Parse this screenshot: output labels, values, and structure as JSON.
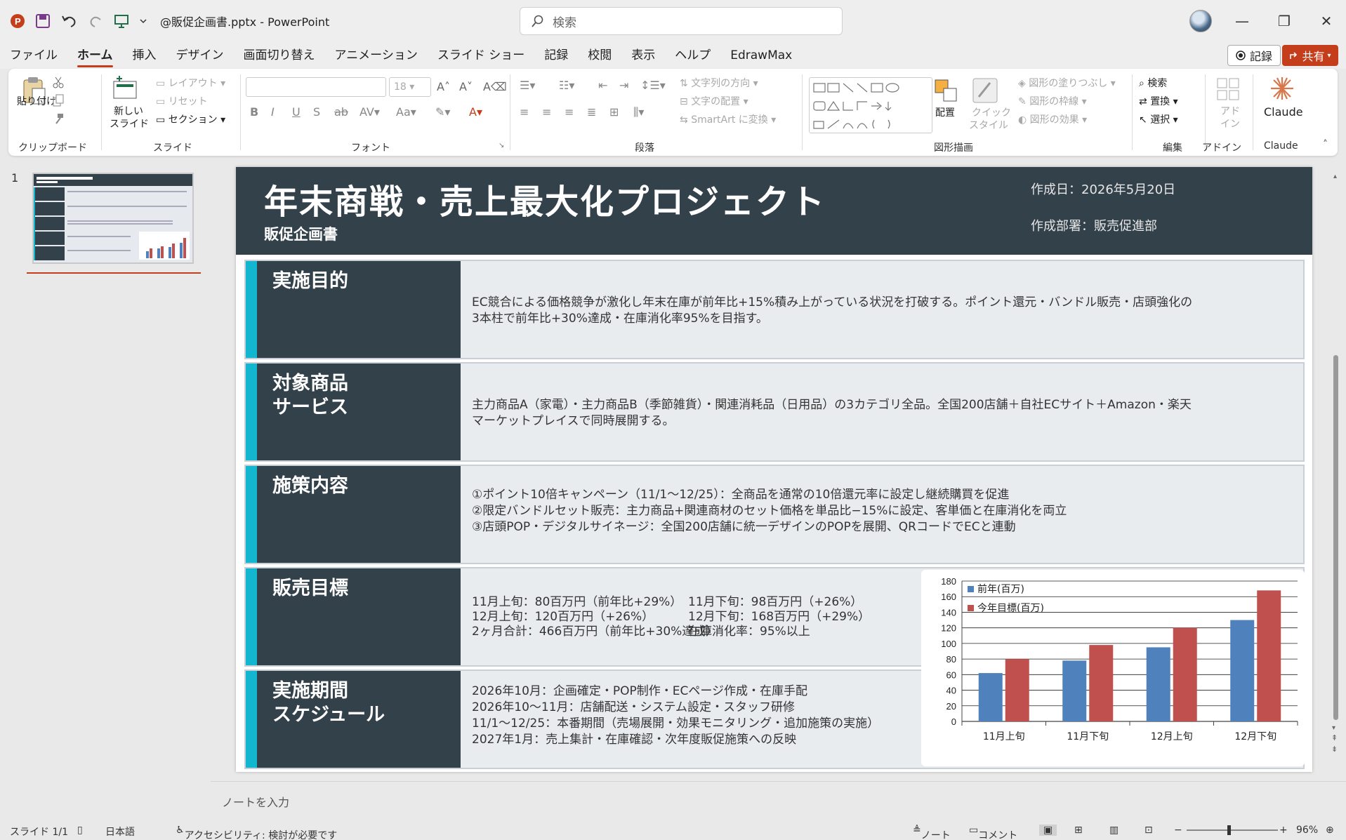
{
  "window": {
    "file_title": "@販促企画書.pptx",
    "sep": "-",
    "app_name": "PowerPoint",
    "search_placeholder": "検索",
    "minimize": "—",
    "restore": "❐",
    "close": "✕"
  },
  "menu": {
    "tabs": [
      "ファイル",
      "ホーム",
      "挿入",
      "デザイン",
      "画面切り替え",
      "アニメーション",
      "スライド ショー",
      "記録",
      "校閲",
      "表示",
      "ヘルプ",
      "EdrawMax"
    ],
    "active": "ホーム",
    "record_label": "記録",
    "share_label": "共有"
  },
  "ribbon": {
    "clipboard": {
      "paste": "貼り付け",
      "label": "クリップボード"
    },
    "slides": {
      "new_slide_line1": "新しい",
      "new_slide_line2": "スライド",
      "layout": "レイアウト",
      "reset": "リセット",
      "section": "セクション",
      "label": "スライド"
    },
    "font": {
      "size": "18",
      "label": "フォント"
    },
    "paragraph": {
      "text_direction": "文字列の方向",
      "align_text": "文字の配置",
      "smartart": "SmartArt に変換",
      "label": "段落"
    },
    "drawing": {
      "arrange": "配置",
      "quick_style_line1": "クイック",
      "quick_style_line2": "スタイル",
      "fill": "図形の塗りつぶし",
      "outline": "図形の枠線",
      "effects": "図形の効果",
      "label": "図形描画"
    },
    "editing": {
      "find": "検索",
      "replace": "置換",
      "select": "選択",
      "label": "編集"
    },
    "addins": {
      "addin_line1": "アド",
      "addin_line2": "イン",
      "label": "アドイン"
    },
    "claude": {
      "button": "Claude",
      "label": "Claude"
    }
  },
  "thumbnail": {
    "number": "1"
  },
  "slide": {
    "title": "年末商戦・売上最大化プロジェクト",
    "subtitle": "販促企画書",
    "date": "作成日：2026年5月20日",
    "dept": "作成部署：販売促進部",
    "purpose": {
      "label": "実施目的",
      "text": [
        "EC競合による価格競争が激化し年末在庫が前年比+15%積み上がっている状況を打破する。ポイント還元・バンドル販売・店頭強化の",
        "3本柱で前年比+30%達成・在庫消化率95%を目指す。"
      ]
    },
    "products": {
      "label_line1": "対象商品",
      "label_line2": "サービス",
      "text": [
        "主力商品A（家電）・主力商品B（季節雑貨）・関連消耗品（日用品）の3カテゴリ全品。全国200店舗＋自社ECサイト＋Amazon・楽天",
        "マーケットプレイスで同時展開する。"
      ]
    },
    "measures": {
      "label": "施策内容",
      "text": [
        "①ポイント10倍キャンペーン（11/1〜12/25）：全商品を通常の10倍還元率に設定し継続購買を促進",
        "②限定バンドルセット販売：主力商品+関連商材のセット価格を単品比−15%に設定、客単価と在庫消化を両立",
        "③店頭POP・デジタルサイネージ：全国200店舗に統一デザインのPOPを展開、QRコードでECと連動"
      ]
    },
    "targets": {
      "label": "販売目標",
      "c1": [
        "11月上旬：80百万円（前年比+29%）",
        "12月上旬：120百万円（+26%）",
        "2ヶ月合計：466百万円（前年比+30%達成）"
      ],
      "c2": [
        "11月下旬：98百万円（+26%）",
        "12月下旬：168百万円（+29%）",
        "在庫消化率：95%以上"
      ]
    },
    "schedule": {
      "label_line1": "実施期間",
      "label_line2": "スケジュール",
      "text": [
        "2026年10月：企画確定・POP制作・ECページ作成・在庫手配",
        "2026年10〜11月：店舗配送・システム設定・スタッフ研修",
        "11/1〜12/25：本番期間（売場展開・効果モニタリング・追加施策の実施）",
        "2027年1月：売上集計・在庫確認・次年度販促施策への反映"
      ]
    }
  },
  "chart_data": {
    "type": "bar",
    "categories": [
      "11月上旬",
      "11月下旬",
      "12月上旬",
      "12月下旬"
    ],
    "series": [
      {
        "name": "前年(百万)",
        "values": [
          62,
          78,
          95,
          130
        ],
        "color": "#4f81bd"
      },
      {
        "name": "今年目標(百万)",
        "values": [
          80,
          98,
          120,
          168
        ],
        "color": "#c0504d"
      }
    ],
    "ylim": [
      0,
      180
    ],
    "yticks": [
      "0",
      "20",
      "40",
      "60",
      "80",
      "100",
      "120",
      "140",
      "160",
      "180"
    ],
    "grid": true,
    "legend": "top-left"
  },
  "notes": {
    "placeholder": "ノートを入力"
  },
  "status": {
    "slide": "スライド 1/1",
    "lang": "日本語",
    "access": "アクセシビリティ: 検討が必要です",
    "notes": "ノート",
    "comments": "コメント",
    "zoom": "96%"
  }
}
